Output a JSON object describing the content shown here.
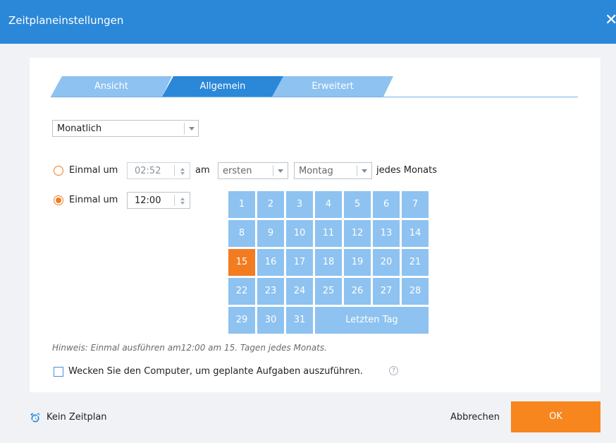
{
  "window": {
    "title": "Zeitplaneinstellungen",
    "close": "✕"
  },
  "tabs": [
    {
      "label": "Ansicht"
    },
    {
      "label": "Allgemein"
    },
    {
      "label": "Erweitert"
    }
  ],
  "frequency": {
    "value": "Monatlich"
  },
  "option1": {
    "label": "Einmal um",
    "time": "02:52",
    "am": "am",
    "week": "ersten",
    "weekday": "Montag",
    "suffix": "jedes Monats"
  },
  "option2": {
    "label": "Einmal um",
    "time": "12:00"
  },
  "calendar": {
    "days": [
      "1",
      "2",
      "3",
      "4",
      "5",
      "6",
      "7",
      "8",
      "9",
      "10",
      "11",
      "12",
      "13",
      "14",
      "15",
      "16",
      "17",
      "18",
      "19",
      "20",
      "21",
      "22",
      "23",
      "24",
      "25",
      "26",
      "27",
      "28",
      "29",
      "30",
      "31"
    ],
    "last_day": "Letzten Tag",
    "selected": "15"
  },
  "hint": "Hinweis: Einmal ausführen am12:00 am 15. Tagen jedes Monats.",
  "wake": {
    "label": "Wecken Sie den Computer, um geplante Aufgaben auszuführen.",
    "help": "?"
  },
  "footer": {
    "no_schedule": "Kein Zeitplan",
    "cancel": "Abbrechen",
    "ok": "OK"
  },
  "colors": {
    "titlebar": "#2b87d8",
    "accent": "#f37b20",
    "tab_active": "#2b87d8",
    "tab_inactive": "#8ec2f0",
    "day": "#8ec2f0"
  }
}
